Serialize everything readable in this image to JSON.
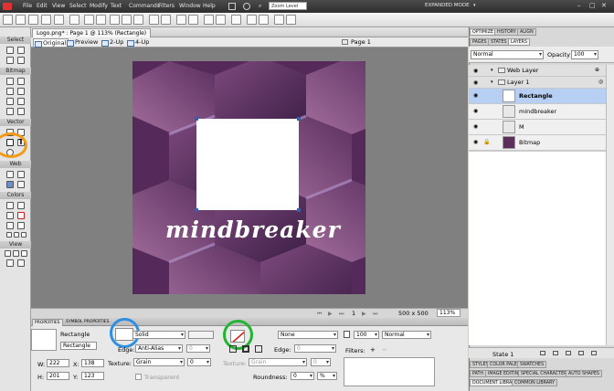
{
  "menubar": {
    "items": [
      "File",
      "Edit",
      "View",
      "Select",
      "Modify",
      "Text",
      "Commands",
      "Filters",
      "Window",
      "Help"
    ],
    "zoom": "Zoom Level",
    "mode": "EXPANDED MODE"
  },
  "document_tab": {
    "title": "Logo.png* : Page 1 @ 113% (Rectangle)"
  },
  "view_tabs": [
    "Original",
    "Preview",
    "2-Up",
    "4-Up"
  ],
  "page": "Page 1",
  "canvas": {
    "text": "mindbreaker"
  },
  "status": {
    "page_index": "1",
    "size": "500 x 500",
    "zoom": "113%"
  },
  "tools": {
    "sections": [
      "Select",
      "Bitmap",
      "Vector",
      "Web",
      "Colors",
      "View"
    ]
  },
  "properties": {
    "tabs": [
      "PROPERTIES",
      "SYMBOL PROPERTIES"
    ],
    "object_type": "Rectangle",
    "object_name": "Rectangle",
    "fill": "Solid",
    "edge": "Anti-Alias",
    "edge_amount": "0",
    "texture": "Grain",
    "texture_amount": "0",
    "transparent": "Transparent",
    "stroke": "None",
    "stroke_edge": "Edge:",
    "stroke_edge_val": "0",
    "stroke_texture": "Texture:",
    "stroke_texture_val": "Grain",
    "stroke_texture_amount": "0",
    "roundness": "Roundness:",
    "roundness_val": "0",
    "roundness_unit": "%",
    "opacity": "100",
    "blend": "Normal",
    "filters": "Filters:",
    "w": "222",
    "x": "138",
    "h": "201",
    "y": "123",
    "w_label": "W:",
    "x_label": "X:",
    "h_label": "H:",
    "y_label": "Y:"
  },
  "right_panel": {
    "top_tabs": [
      "OPTIMIZE",
      "HISTORY",
      "ALIGN"
    ],
    "layer_tabs": [
      "PAGES",
      "STATES",
      "LAYERS"
    ],
    "blend": "Normal",
    "opacity_label": "Opacity",
    "opacity": "100",
    "layers": [
      {
        "name": "Web Layer"
      },
      {
        "name": "Layer 1"
      },
      {
        "name": "Rectangle"
      },
      {
        "name": "mindbreaker"
      },
      {
        "name": "M"
      },
      {
        "name": "Bitmap"
      }
    ],
    "state": "State 1",
    "bottom_tabs": [
      "STYLES",
      "COLOR PALETTE",
      "SWATCHES"
    ],
    "bottom_tabs2": [
      "PATH",
      "IMAGE EDITING",
      "SPECIAL CHARACTERS",
      "AUTO SHAPES"
    ],
    "bottom_tabs3": [
      "DOCUMENT LIBRARY",
      "COMMON LIBRARY"
    ]
  },
  "colors": {
    "orange": "#f39b17",
    "blue": "#2f8fe0",
    "green": "#22b533",
    "selected": "#b7cff2"
  }
}
